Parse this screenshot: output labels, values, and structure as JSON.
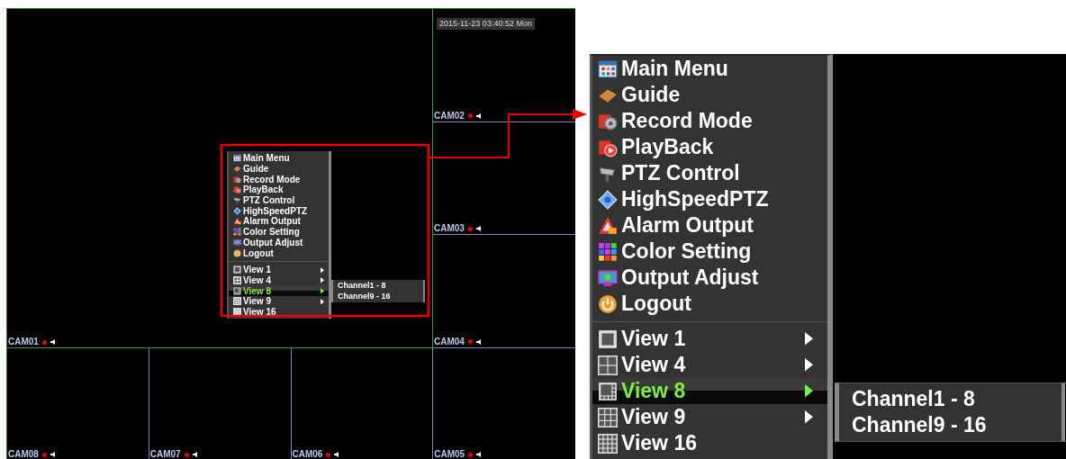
{
  "screen": {
    "timestamp": "2015-11-23 03:40:52 Mon",
    "cameras": [
      {
        "label": "CAM01"
      },
      {
        "label": "CAM02"
      },
      {
        "label": "CAM03"
      },
      {
        "label": "CAM04"
      },
      {
        "label": "CAM08"
      },
      {
        "label": "CAM07"
      },
      {
        "label": "CAM06"
      },
      {
        "label": "CAM05"
      }
    ]
  },
  "menu": {
    "items": [
      {
        "label": "Main Menu",
        "kind": "mainmenu"
      },
      {
        "label": "Guide",
        "kind": "guide"
      },
      {
        "label": "Record Mode",
        "kind": "record"
      },
      {
        "label": "PlayBack",
        "kind": "playback"
      },
      {
        "label": "PTZ Control",
        "kind": "ptz"
      },
      {
        "label": "HighSpeedPTZ",
        "kind": "highspeed"
      },
      {
        "label": "Alarm Output",
        "kind": "alarm"
      },
      {
        "label": "Color Setting",
        "kind": "color"
      },
      {
        "label": "Output Adjust",
        "kind": "output"
      },
      {
        "label": "Logout",
        "kind": "logout"
      }
    ],
    "views": [
      {
        "label": "View 1",
        "kind": "view1",
        "selected": false,
        "has_submenu": true
      },
      {
        "label": "View 4",
        "kind": "view4",
        "selected": false,
        "has_submenu": true
      },
      {
        "label": "View 8",
        "kind": "view8",
        "selected": true,
        "has_submenu": true,
        "submenu": [
          "Channel1 - 8",
          "Channel9 - 16"
        ]
      },
      {
        "label": "View 9",
        "kind": "view9",
        "selected": false,
        "has_submenu": true
      },
      {
        "label": "View 16",
        "kind": "view16",
        "selected": false,
        "has_submenu": false
      }
    ]
  },
  "zoomed_menu": {
    "items": [
      {
        "label": "Main Menu",
        "kind": "mainmenu"
      },
      {
        "label": "Guide",
        "kind": "guide"
      },
      {
        "label": "Record Mode",
        "kind": "record"
      },
      {
        "label": "PlayBack",
        "kind": "playback"
      },
      {
        "label": "PTZ Control",
        "kind": "ptz"
      },
      {
        "label": "HighSpeedPTZ",
        "kind": "highspeed"
      },
      {
        "label": "Alarm Output",
        "kind": "alarm"
      },
      {
        "label": "Color Setting",
        "kind": "color"
      },
      {
        "label": "Output Adjust",
        "kind": "output"
      },
      {
        "label": "Logout",
        "kind": "logout"
      }
    ],
    "views": [
      {
        "label": "View 1",
        "kind": "view1",
        "selected": false,
        "has_submenu": true
      },
      {
        "label": "View 4",
        "kind": "view4",
        "selected": false,
        "has_submenu": true
      },
      {
        "label": "View 8",
        "kind": "view8",
        "selected": true,
        "has_submenu": true,
        "submenu": [
          "Channel1 - 8",
          "Channel9 - 16"
        ]
      },
      {
        "label": "View 9",
        "kind": "view9",
        "selected": false,
        "has_submenu": true
      },
      {
        "label": "View 16",
        "kind": "view16",
        "selected": false,
        "has_submenu": false
      }
    ]
  }
}
